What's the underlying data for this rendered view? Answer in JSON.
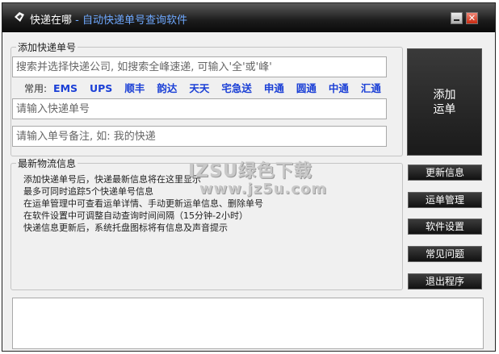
{
  "window": {
    "title": "快递在哪",
    "subtitle": " - 自动快递单号查询软件",
    "close_glyph": "✕"
  },
  "add_section": {
    "legend": "添加快递单号",
    "search_placeholder": "搜索并选择快递公司, 如搜索全峰速递, 可输入'全'或'峰'",
    "common_label": "常用:",
    "couriers": [
      "EMS",
      "UPS",
      "顺丰",
      "韵达",
      "天天",
      "宅急送",
      "申通",
      "圆通",
      "中通",
      "汇通"
    ],
    "tracking_placeholder": "请输入快递单号",
    "note_placeholder": "请输入单号备注, 如: 我的快递",
    "add_button_line1": "添加",
    "add_button_line2": "运单"
  },
  "info_section": {
    "legend": "最新物流信息",
    "lines": [
      "添加快递单号后，快递最新信息将在这里显示",
      "最多可同时追踪5个快递单号信息",
      "在运单管理中可查看运单详情、手动更新运单信息、删除单号",
      "在软件设置中可调整自动查询时间间隔（15分钟-2小时）",
      "快递信息更新后，系统托盘图标将有信息及声音提示"
    ]
  },
  "side_buttons": [
    "更新信息",
    "运单管理",
    "软件设置",
    "常见问题",
    "退出程序"
  ],
  "watermark": {
    "line1": "IZSU绿色下载",
    "line2": "www.jz5u.com"
  }
}
